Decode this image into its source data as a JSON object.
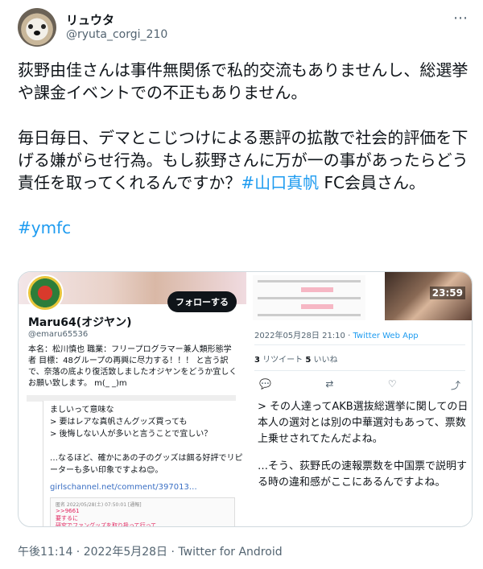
{
  "tweet": {
    "author": {
      "display_name": "リュウタ",
      "handle": "@ryuta_corgi_210"
    },
    "more_icon": "ellipsis-icon",
    "paragraphs": {
      "p1": "荻野由佳さんは事件無関係で私的交流もありませんし、総選挙や課金イベントでの不正もありません。",
      "p2_text": "毎日毎日、デマとこじつけによる悪評の拡散で社会的評価を下げる嫌がらせ行為。もし荻野さんに万が一の事があったらどう責任を取ってくれるんですか？",
      "p2_hashtag": "#山口真帆",
      "p2_tail": " FC会員さん。",
      "p3_hashtag": "#ymfc"
    },
    "footer": "午後11:14 · 2022年5月28日 · Twitter for Android"
  },
  "media": {
    "left_top": {
      "follow_label": "フォローする",
      "profile_name": "Maru64(オジヤン)",
      "profile_handle": "@emaru65536",
      "bio": "本名：松川慎也 職業：フリープログラマー兼人類形態学者 目標：48グループの再興に尽力する！！！ と言う訳で、奈落の底より復活致しましたオジヤンをどうか宜しくお願い致します。 m(_ _)m"
    },
    "left_bottom": {
      "text": "ましいって意味な\n> 要はレアな真帆さんグッズ買っても\n> 後悔しない人が多いと言うことで宜しい？\n\n…なるほど、確かにあの子のグッズは餌る好評でリピーターも多い印象ですよね😊。",
      "link": "girlschannel.net/comment/397013…",
      "quote_head": "匿名 2022/05/28(土) 07:50:01 [通報]",
      "quote_red": ">>9661\n要するに\n研究でファングッズを取り扱って行って"
    },
    "right_top": {
      "clock": "23:59",
      "date": "2022年05月28日 21:10 · ",
      "source": "Twitter Web App",
      "retweets_count": "3",
      "retweets_label": " リツイート  ",
      "likes_count": "5",
      "likes_label": " いいね"
    },
    "right_bottom": {
      "p1": "> その人達ってAKB選抜総選挙に関しての日本人の選対とは別の中華選対もあって、票数上乗せされてたんだよね。",
      "p2": "…そう、荻野氏の速報票数を中国票で説明する時の違和感がここにあるんですよね。"
    }
  },
  "colors": {
    "text": "#0f1419",
    "secondary": "#536471",
    "link": "#1d9bf0",
    "border": "#cfd9de"
  }
}
